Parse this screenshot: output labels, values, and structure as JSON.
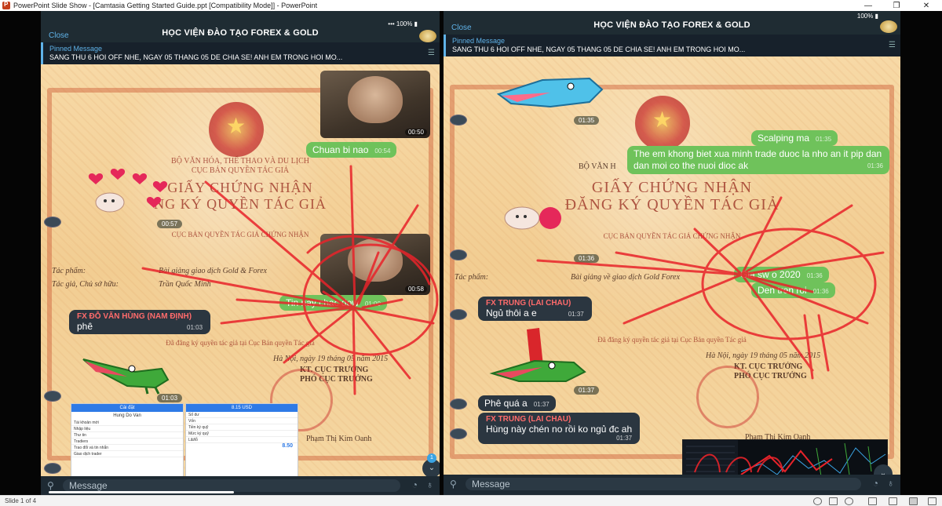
{
  "window": {
    "title": "PowerPoint Slide Show - [Camtasia Getting Started Guide.ppt [Compatibility Mode]] - PowerPoint",
    "minimize": "—",
    "maximize": "❐",
    "close": "✕"
  },
  "statusbar": {
    "slide": "Slide 1 of 4"
  },
  "left": {
    "header": {
      "close": "Close",
      "title": "HỌC VIỆN ĐÀO TẠO FOREX & GOLD",
      "status": "••• 100% ▮"
    },
    "pinned": {
      "label": "Pinned Message",
      "text": "SANG THU 6 HOI OFF NHE, NGAY 05 THANG 05 DE CHIA SE! ANH EM TRONG HOI MO..."
    },
    "cert": {
      "ministry1": "BỘ VĂN HÓA, THỂ THAO VÀ DU LỊCH",
      "ministry2": "CỤC BẢN QUYỀN TÁC GIẢ",
      "heading1": "GIẤY CHỨNG NHẬN",
      "heading2": "NG KÝ QUYỀN TÁC GIẢ",
      "sub": "CỤC BẢN QUYỀN TÁC GIẢ CHỨNG NHẬN",
      "work_label": "Tác phẩm:",
      "work_value": "Bài giảng giao dịch Gold & Forex",
      "author_label": "Tác giả, Chủ sở hữu:",
      "author_value": "Trần Quốc Minh",
      "reg": "Đã đăng ký quyền tác giả tại Cục Bản quyền Tác giả",
      "date": "Hà Nội, ngày 19 tháng 05 năm 2015",
      "signer1": "KT. CỤC TRƯỞNG",
      "signer2": "PHÓ CỤC TRƯỞNG",
      "signer_name": "Phạm Thị Kim Oanh"
    },
    "messages": {
      "m1_time": "00:50",
      "m2_text": "Chuan bi nao",
      "m2_time": "00:54",
      "m3_time": "00:57",
      "m4_time": "00:58",
      "m5_text": "Tin nay chac dow",
      "m5_time": "01:00",
      "m6_sender": "FX ĐỖ VĂN HÙNG (NAM ĐỊNH)",
      "m6_text": "phê",
      "m6_time": "01:03",
      "m7_time": "01:03"
    },
    "screenshot": {
      "a_title": "Cài đặt",
      "a_name": "Hung Do Van",
      "a_rows": [
        "Tài khoản mới",
        "Nhập liệu",
        "Thư tin",
        "Tradiers",
        "Trao đổi và tin nhắn",
        "Giao dịch trader"
      ],
      "b_title": "8.15 USD",
      "b_rows": [
        "Số dư",
        "Vốn",
        "Tiền ký quỹ",
        "Mức ký quỹ",
        "Lãi/lỗ"
      ],
      "b_value": "8.50"
    },
    "input": {
      "placeholder": "Message",
      "badge": "1"
    }
  },
  "right": {
    "header": {
      "close": "Close",
      "title": "HỌC VIỆN ĐÀO TẠO FOREX & GOLD",
      "status": "100% ▮"
    },
    "pinned": {
      "label": "Pinned Message",
      "text": "SANG THU 6 HOI OFF NHE, NGAY 05 THANG 05 DE CHIA SE! ANH EM TRONG HOI MO..."
    },
    "cert": {
      "ministry1": "BỘ VĂN H",
      "heading1": "GIẤY CHỨNG NHẬN",
      "heading2": "ĐĂNG KÝ QUYỀN TÁC GIẢ",
      "sub": "CỤC BẢN QUYỀN TÁC GIẢ CHỨNG NHẬN",
      "work_label": "Tác phẩm:",
      "work_value": "Bài giảng về giao dịch Gold Forex",
      "reg": "Đã đăng ký quyền tác giả tại Cục Bản quyền Tác giả",
      "date": "Hà Nội, ngày 19 tháng 05 năm 2015",
      "signer1": "KT. CỤC TRƯỞNG",
      "signer2": "PHÓ CỤC TRƯỞNG",
      "signer_name": "Phạm Thị Kim Oanh"
    },
    "messages": {
      "m1_time": "01:35",
      "m2_text": "Scalping ma",
      "m2_time": "01:35",
      "m3_text": "The em khong biet xua minh trade duoc la nho an it pip dan dan moi co the nuoi dioc ak",
      "m3_time": "01:36",
      "m4_time": "01:36",
      "m5_text": "Gia sw o 2020",
      "m5_time": "01:36",
      "m6_text": "Den tren roi",
      "m6_time": "01:36",
      "m7_sender": "FX TRUNG (LAI CHAU)",
      "m7_text": "Ngủ thôi a e",
      "m7_time": "01:37",
      "m8_time": "01:37",
      "m9_text": "Phê quá a",
      "m9_time": "01:37",
      "m10_sender": "FX TRUNG (LAI CHAU)",
      "m10_text": "Hùng này chén no rồi ko ngủ đc ah",
      "m10_time": "01:37"
    },
    "input": {
      "placeholder": "Message"
    }
  },
  "colors": {
    "outgoing": "#6fc25b",
    "incoming": "#2b3640",
    "sender": "#ff6b6b",
    "link": "#5fb2e8",
    "annotation": "#e8232a"
  }
}
